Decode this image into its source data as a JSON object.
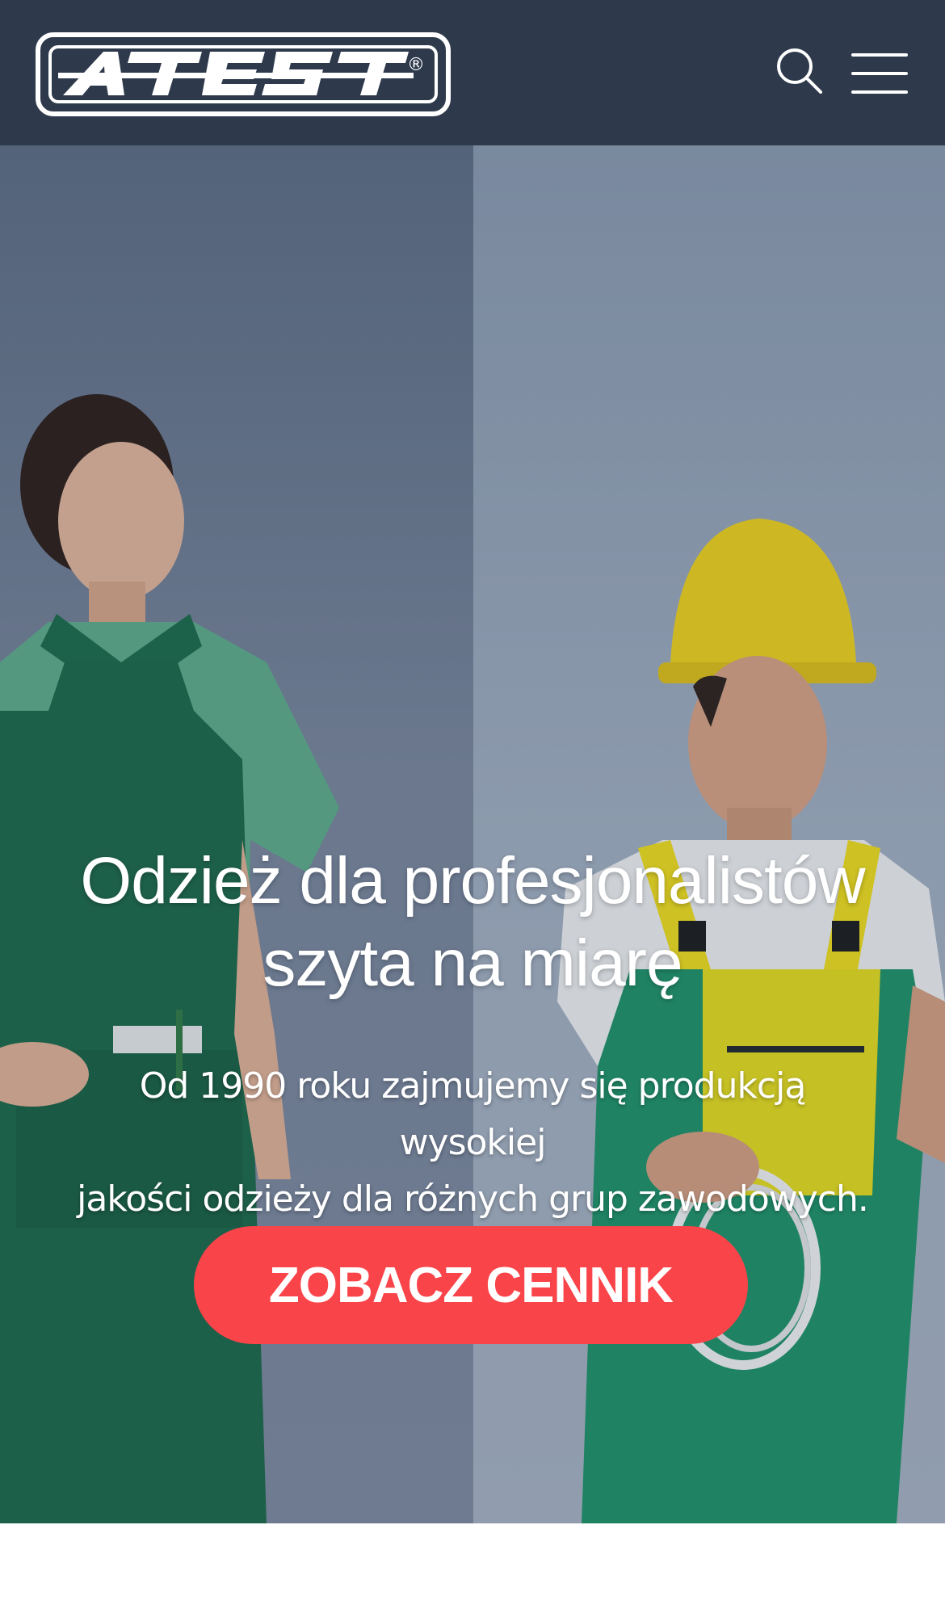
{
  "header": {
    "logo_text": "ATEST",
    "logo_mark": "®",
    "search_icon": "search-icon",
    "menu_icon": "hamburger-menu-icon",
    "background_color": "#2e3a4c"
  },
  "hero": {
    "title_line1": "Odzież dla profesjonalistów",
    "title_line2": "szyta na miarę",
    "subtitle_line1": "Od 1990 roku zajmujemy się produkcją wysokiej",
    "subtitle_line2": "jakości odzieży dla różnych grup zawodowych.",
    "cta_label": "ZOBACZ CENNIK",
    "cta_color": "#f94449"
  }
}
